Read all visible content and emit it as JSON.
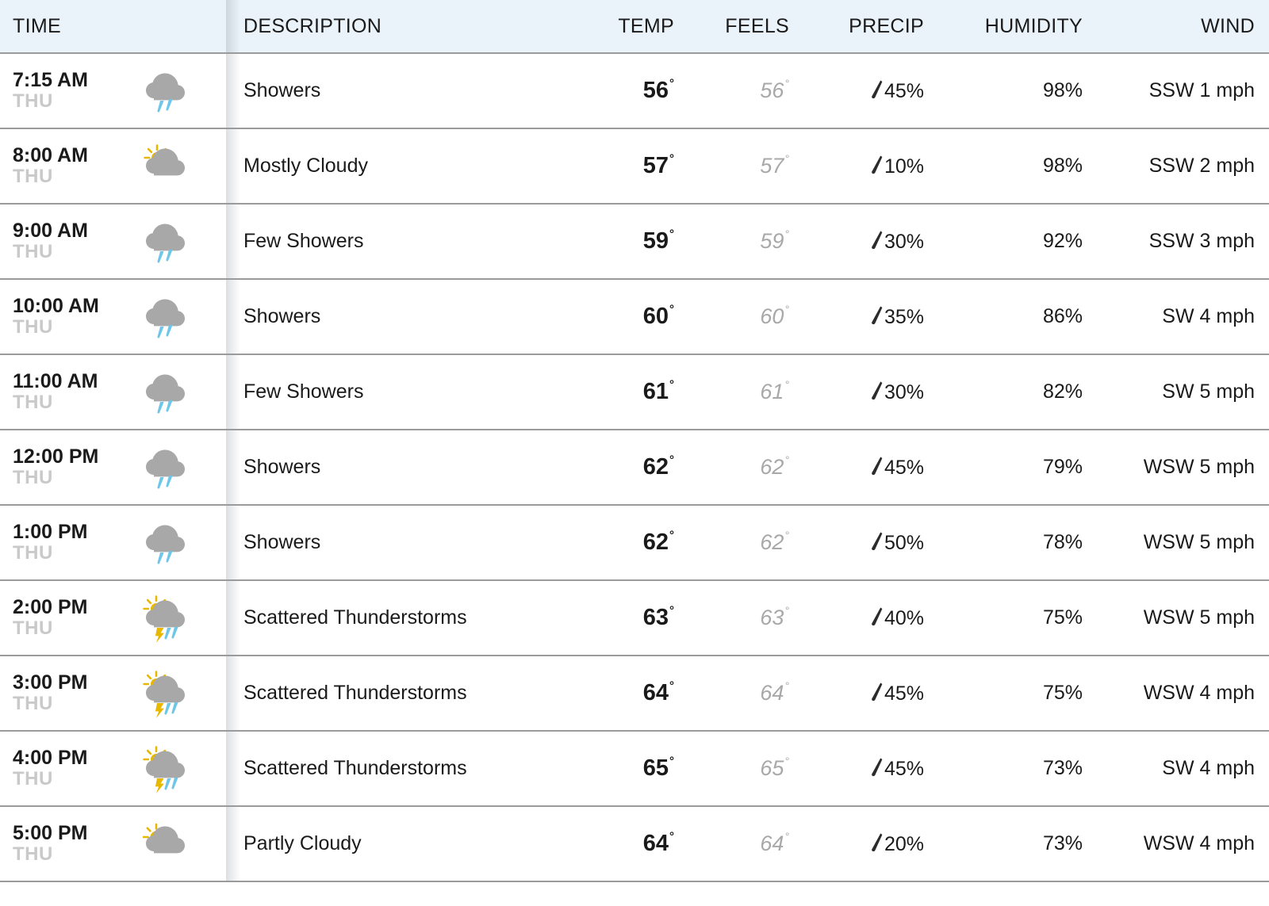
{
  "table": {
    "columns": [
      {
        "key": "time",
        "label": "TIME"
      },
      {
        "key": "description",
        "label": "DESCRIPTION"
      },
      {
        "key": "temp",
        "label": "TEMP"
      },
      {
        "key": "feels",
        "label": "FEELS"
      },
      {
        "key": "precip",
        "label": "PRECIP"
      },
      {
        "key": "humidity",
        "label": "HUMIDITY"
      },
      {
        "key": "wind",
        "label": "WIND"
      }
    ],
    "icons": {
      "precip": "raindrop-icon",
      "showers": "showers-icon",
      "mostly-cloudy": "mostly-cloudy-icon",
      "scattered-thunderstorms": "scattered-thunderstorms-icon",
      "partly-cloudy": "partly-cloudy-icon"
    },
    "colors": {
      "header_background": "#eaf2fa",
      "row_divider": "#9b9b9b",
      "cloud_gray": "#a8a8a8",
      "sun_yellow": "#e8b800",
      "rain_blue": "#6ec6e8",
      "muted_text": "#c9c9c9",
      "feels_text": "#a8a8a8",
      "primary_text": "#1a1a1a"
    },
    "rows": [
      {
        "time": "7:15 AM",
        "day": "THU",
        "icon": "showers",
        "description": "Showers",
        "temp": "56",
        "feels": "56",
        "precip": "45%",
        "humidity": "98%",
        "wind": "SSW 1 mph"
      },
      {
        "time": "8:00 AM",
        "day": "THU",
        "icon": "mostly-cloudy",
        "description": "Mostly Cloudy",
        "temp": "57",
        "feels": "57",
        "precip": "10%",
        "humidity": "98%",
        "wind": "SSW 2 mph"
      },
      {
        "time": "9:00 AM",
        "day": "THU",
        "icon": "showers",
        "description": "Few Showers",
        "temp": "59",
        "feels": "59",
        "precip": "30%",
        "humidity": "92%",
        "wind": "SSW 3 mph"
      },
      {
        "time": "10:00 AM",
        "day": "THU",
        "icon": "showers",
        "description": "Showers",
        "temp": "60",
        "feels": "60",
        "precip": "35%",
        "humidity": "86%",
        "wind": "SW 4 mph"
      },
      {
        "time": "11:00 AM",
        "day": "THU",
        "icon": "showers",
        "description": "Few Showers",
        "temp": "61",
        "feels": "61",
        "precip": "30%",
        "humidity": "82%",
        "wind": "SW 5 mph"
      },
      {
        "time": "12:00 PM",
        "day": "THU",
        "icon": "showers",
        "description": "Showers",
        "temp": "62",
        "feels": "62",
        "precip": "45%",
        "humidity": "79%",
        "wind": "WSW 5 mph"
      },
      {
        "time": "1:00 PM",
        "day": "THU",
        "icon": "showers",
        "description": "Showers",
        "temp": "62",
        "feels": "62",
        "precip": "50%",
        "humidity": "78%",
        "wind": "WSW 5 mph"
      },
      {
        "time": "2:00 PM",
        "day": "THU",
        "icon": "scattered-thunderstorms",
        "description": "Scattered Thunderstorms",
        "temp": "63",
        "feels": "63",
        "precip": "40%",
        "humidity": "75%",
        "wind": "WSW 5 mph"
      },
      {
        "time": "3:00 PM",
        "day": "THU",
        "icon": "scattered-thunderstorms",
        "description": "Scattered Thunderstorms",
        "temp": "64",
        "feels": "64",
        "precip": "45%",
        "humidity": "75%",
        "wind": "WSW 4 mph"
      },
      {
        "time": "4:00 PM",
        "day": "THU",
        "icon": "scattered-thunderstorms",
        "description": "Scattered Thunderstorms",
        "temp": "65",
        "feels": "65",
        "precip": "45%",
        "humidity": "73%",
        "wind": "SW 4 mph"
      },
      {
        "time": "5:00 PM",
        "day": "THU",
        "icon": "partly-cloudy",
        "description": "Partly Cloudy",
        "temp": "64",
        "feels": "64",
        "precip": "20%",
        "humidity": "73%",
        "wind": "WSW 4 mph"
      }
    ]
  }
}
